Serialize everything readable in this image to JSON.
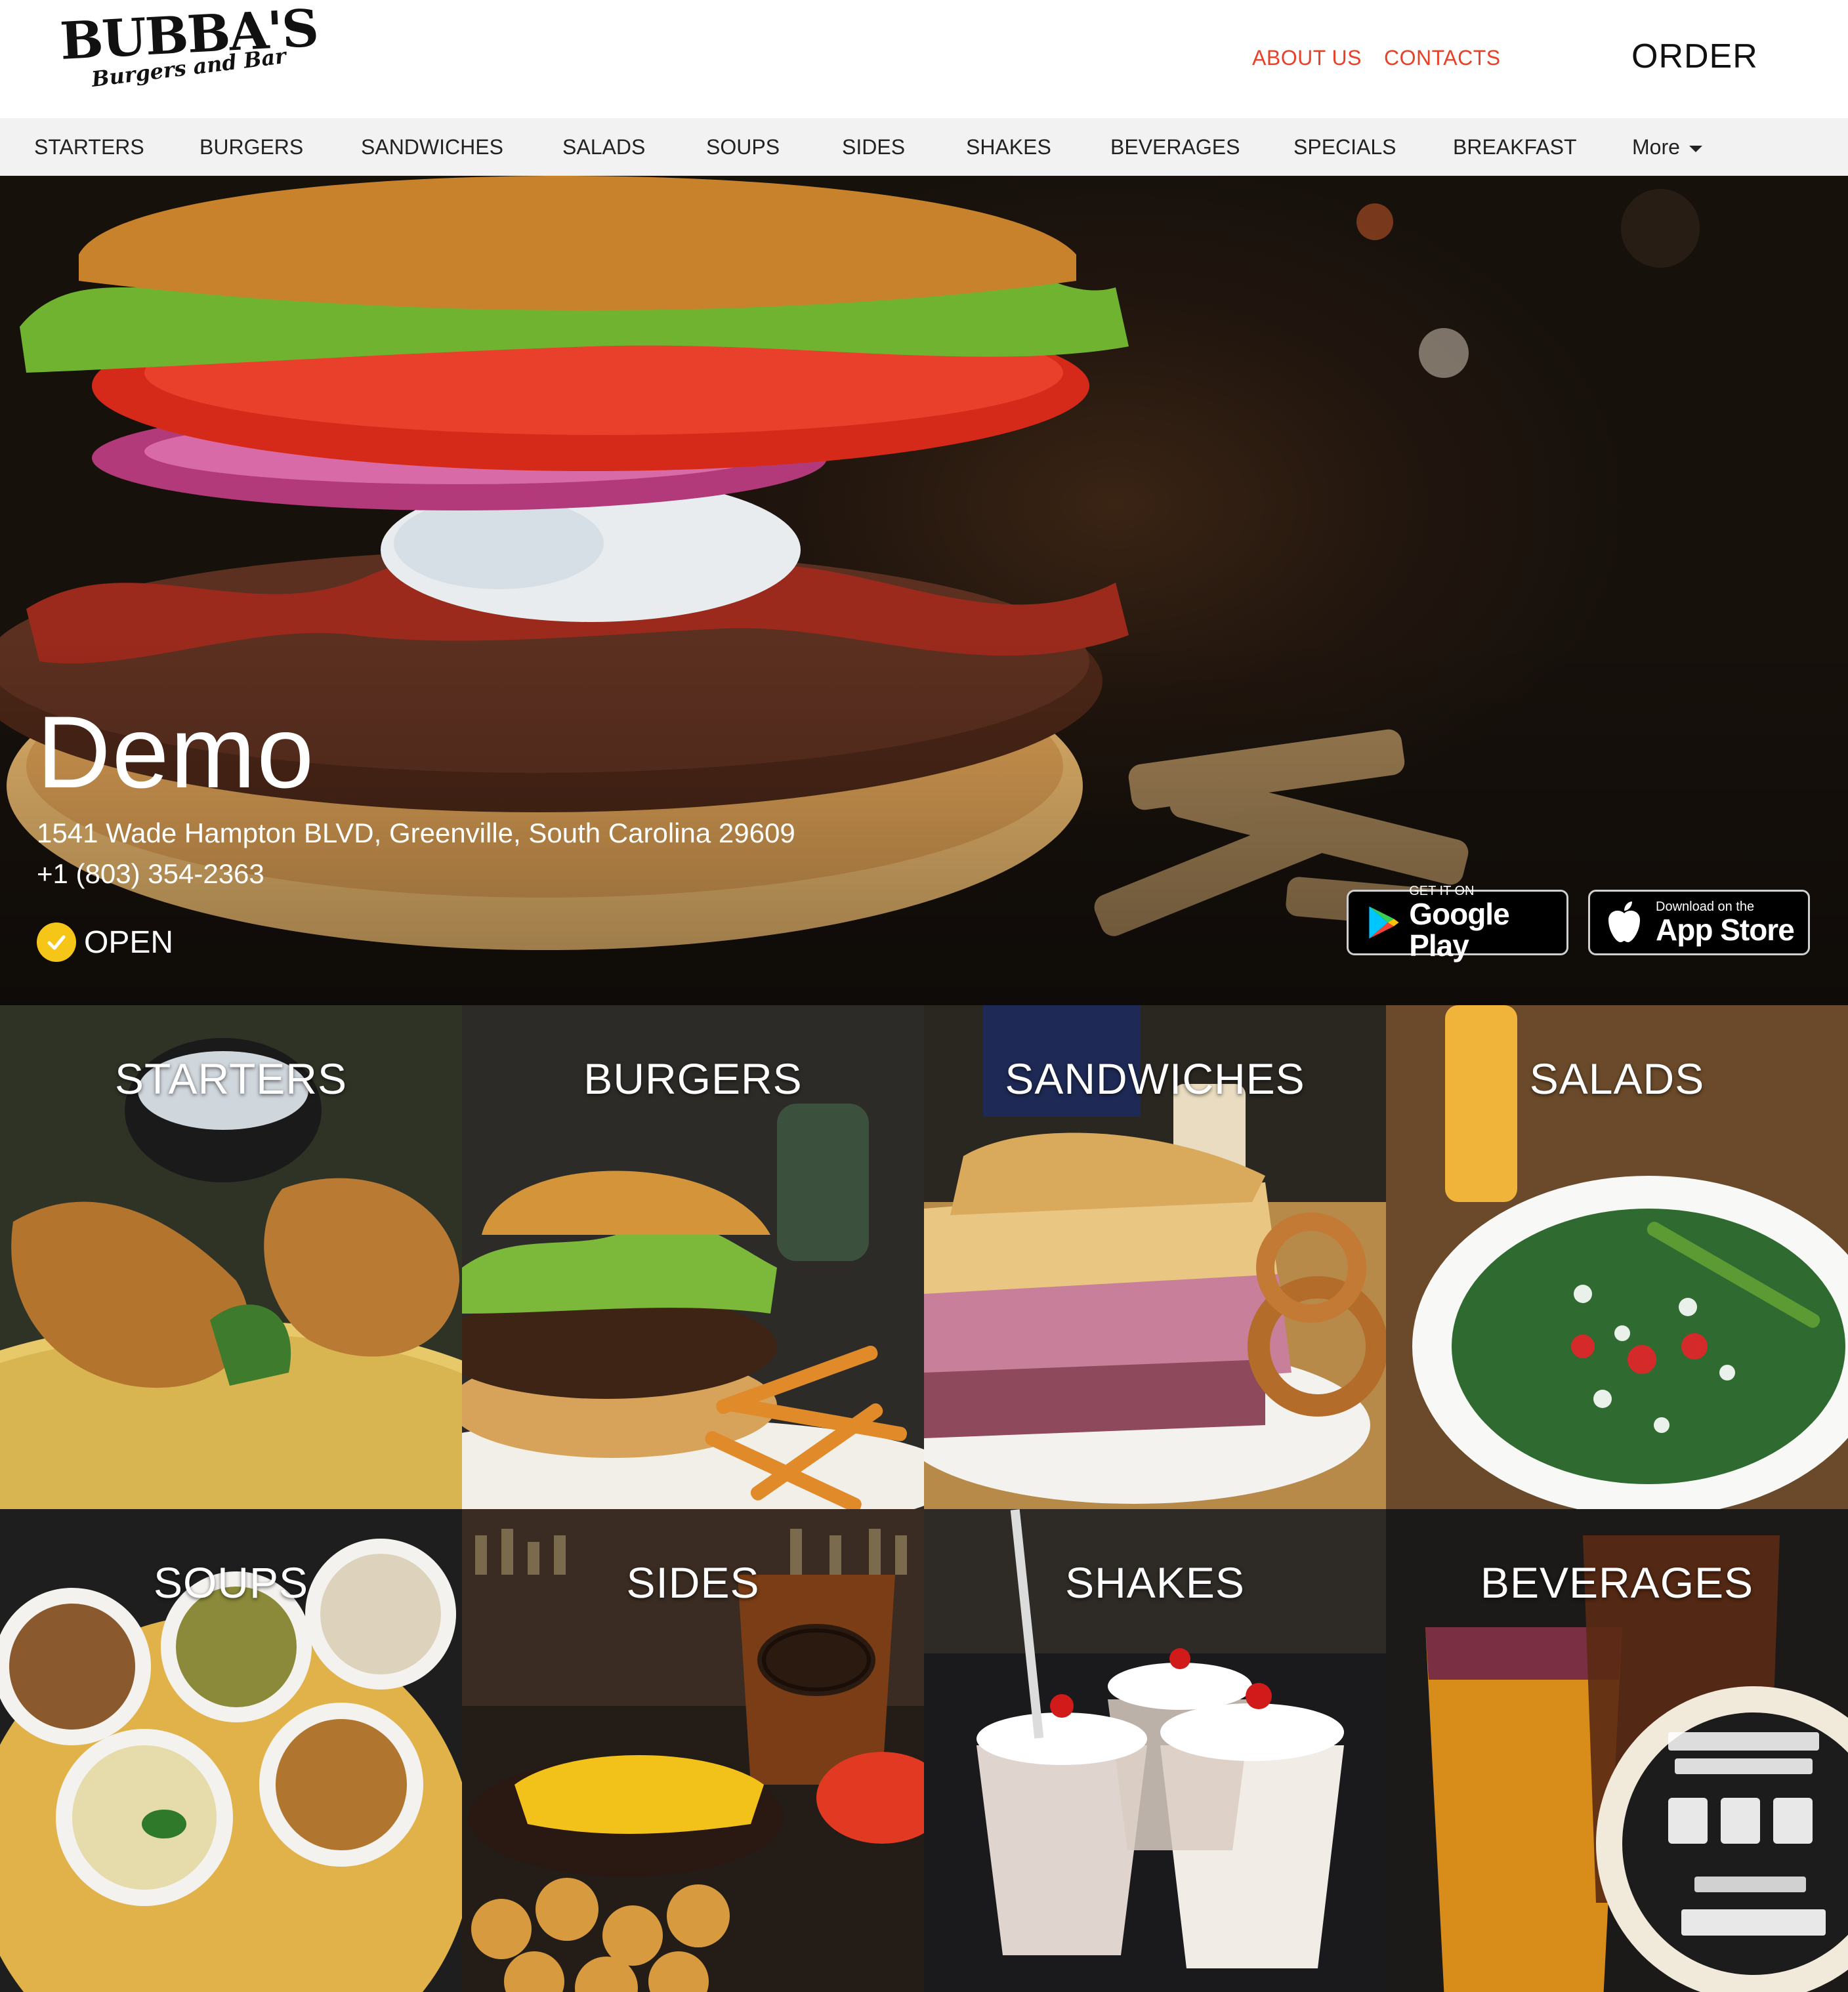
{
  "brand": {
    "name": "BUBBA'S",
    "tagline": "Burgers and Bar"
  },
  "header": {
    "links": [
      "ABOUT US",
      "CONTACTS"
    ],
    "order_label": "ORDER",
    "link_color": "#e8412a"
  },
  "category_nav": {
    "items": [
      "STARTERS",
      "BURGERS",
      "SANDWICHES",
      "SALADS",
      "SOUPS",
      "SIDES",
      "SHAKES",
      "BEVERAGES",
      "SPECIALS",
      "BREAKFAST"
    ],
    "more_label": "More"
  },
  "hero": {
    "title": "Demo",
    "address": "1541 Wade Hampton BLVD, Greenville, South Carolina 29609",
    "phone": "+1 (803) 354-2363",
    "status": "OPEN",
    "status_color": "#f5c518",
    "google_play": {
      "small": "GET IT ON",
      "big": "Google Play"
    },
    "app_store": {
      "small": "Download on the",
      "big": "App Store"
    }
  },
  "tiles": [
    {
      "label": "STARTERS"
    },
    {
      "label": "BURGERS"
    },
    {
      "label": "SANDWICHES"
    },
    {
      "label": "SALADS"
    },
    {
      "label": "SOUPS"
    },
    {
      "label": "SIDES"
    },
    {
      "label": "SHAKES"
    },
    {
      "label": "BEVERAGES"
    }
  ]
}
